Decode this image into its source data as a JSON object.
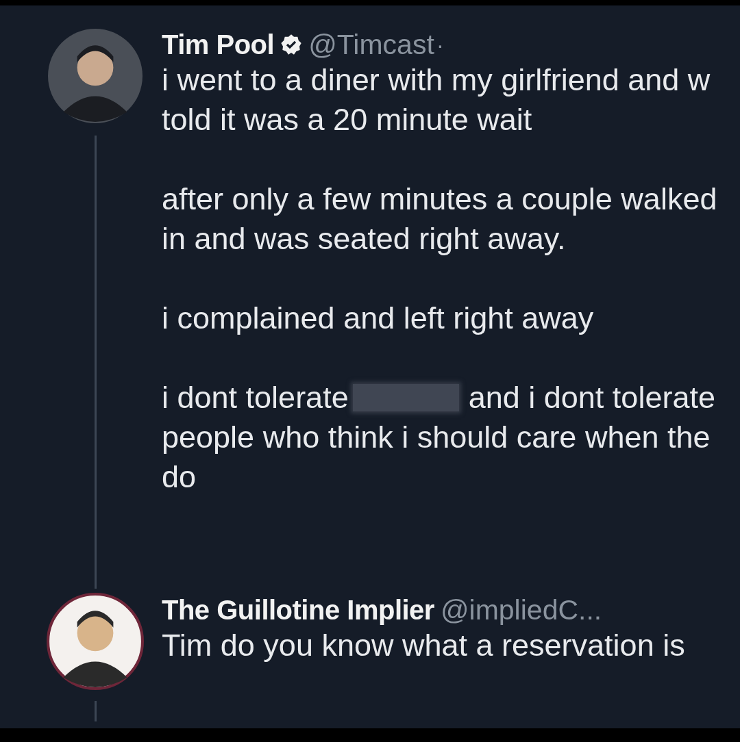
{
  "thread": [
    {
      "author": {
        "name": "Tim Pool",
        "verified": true,
        "handle": "@Timcast",
        "separator": "·"
      },
      "avatar": {
        "kind": "dark"
      },
      "paragraphs": [
        [
          [
            {
              "kind": "text",
              "text": "i went to a diner with my girlfriend and w"
            }
          ],
          [
            {
              "kind": "text",
              "text": "told it was a 20 minute wait"
            }
          ]
        ],
        [
          [
            {
              "kind": "text",
              "text": "after only a few minutes a couple walked"
            }
          ],
          [
            {
              "kind": "text",
              "text": "in and was seated right away."
            }
          ]
        ],
        [
          [
            {
              "kind": "text",
              "text": "i complained and left right away"
            }
          ]
        ],
        [
          [
            {
              "kind": "text",
              "text": "i dont tolerate"
            },
            {
              "kind": "censored"
            },
            {
              "kind": "text",
              "text": "and i dont tolerate"
            }
          ],
          [
            {
              "kind": "text",
              "text": "people who think i should care when the"
            }
          ],
          [
            {
              "kind": "text",
              "text": "do"
            }
          ]
        ]
      ]
    },
    {
      "author": {
        "name": "The Guillotine Implier",
        "verified": false,
        "handle": "@impliedC..."
      },
      "avatar": {
        "kind": "light"
      },
      "paragraphs": [
        [
          [
            {
              "kind": "text",
              "text": "Tim do you know what a reservation is"
            }
          ]
        ]
      ]
    }
  ]
}
